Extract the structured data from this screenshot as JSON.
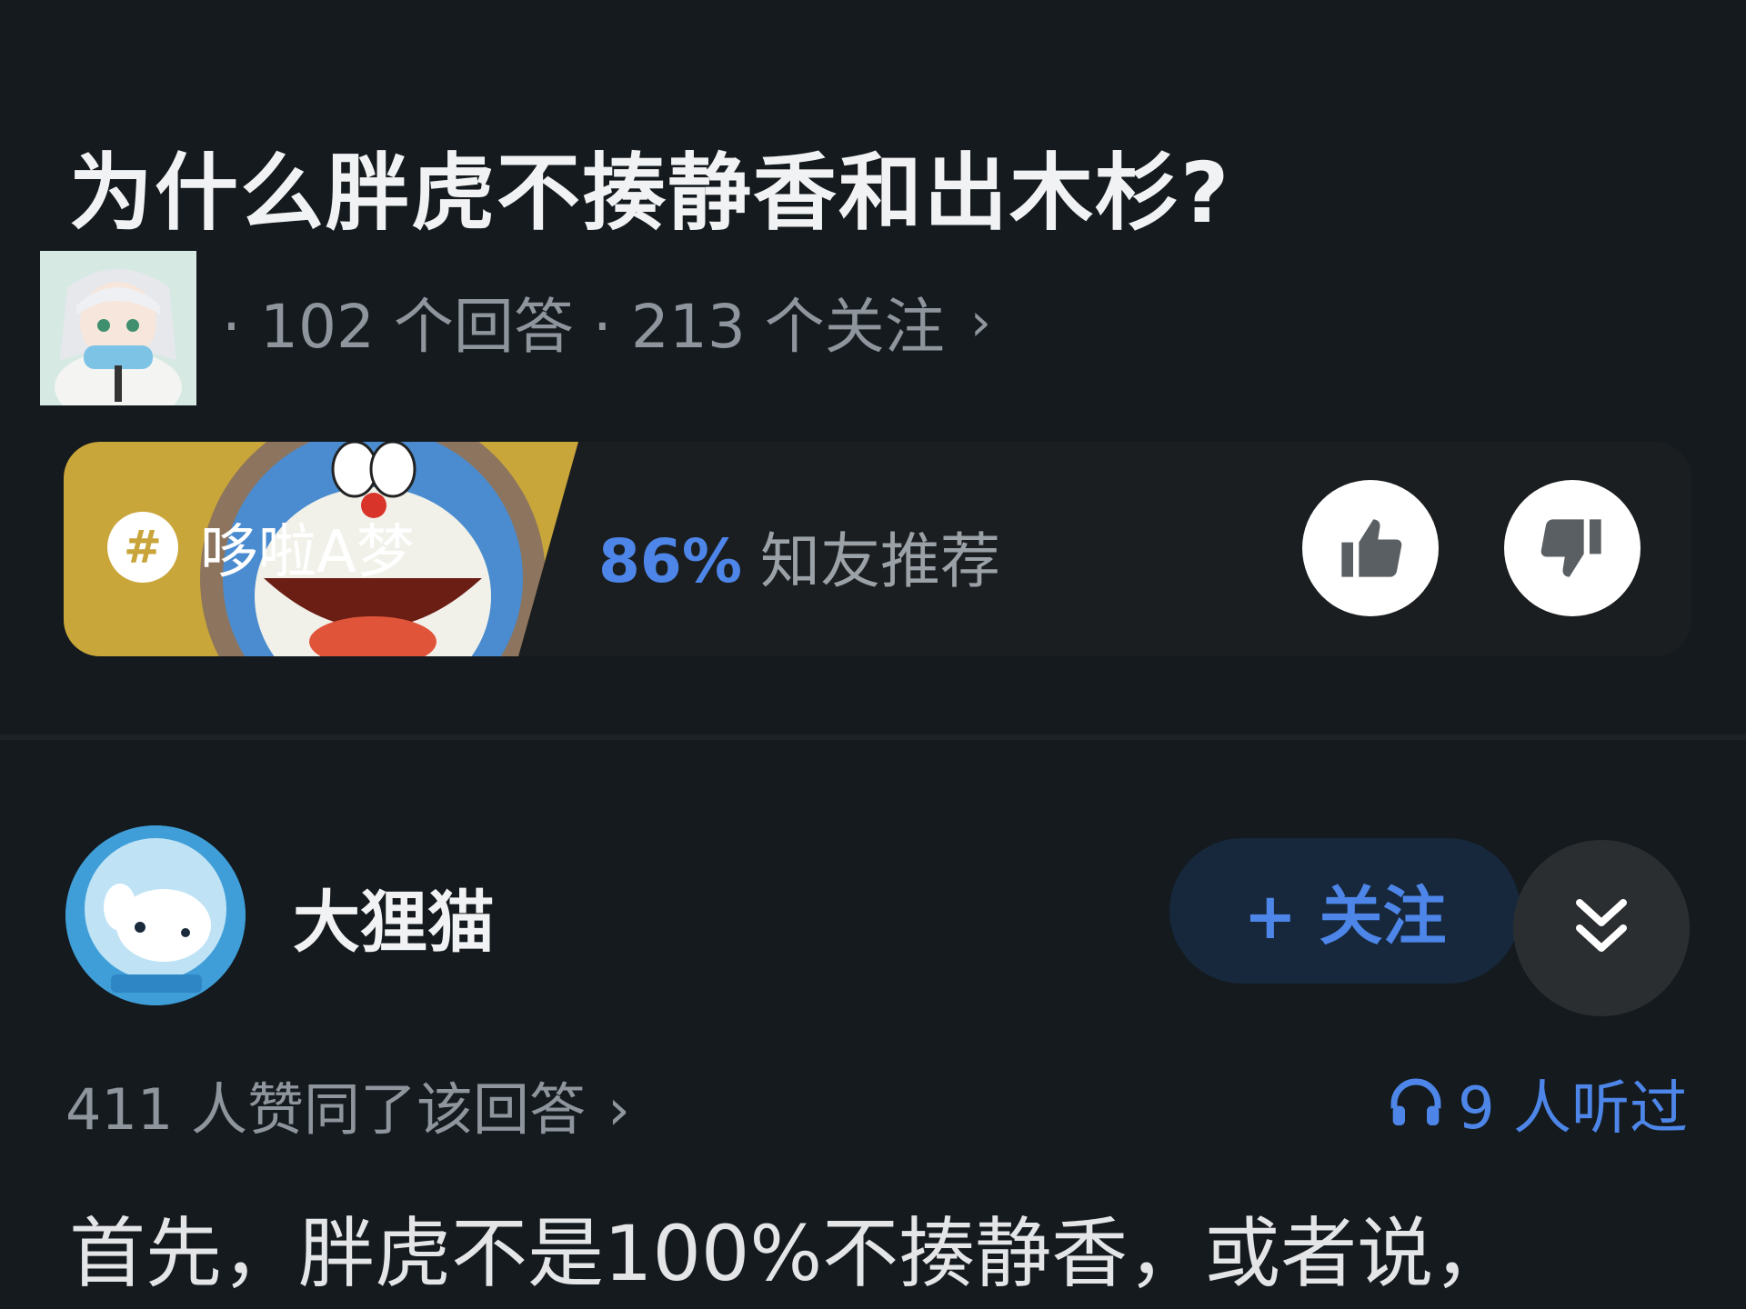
{
  "question": {
    "title": "为什么胖虎不揍静香和出木杉?",
    "meta": "· 102 个回答 · 213 个关注",
    "meta_chevron": "›",
    "avatar_icon": "anime-girl-avatar"
  },
  "topic": {
    "tag_icon": "hash-icon",
    "hash_symbol": "#",
    "name": "哆啦A梦",
    "recommend_percent": "86%",
    "recommend_label": "知友推荐",
    "thumb_colors": {
      "yellow": "#c9a63a",
      "blue": "#4a8ccf",
      "red": "#e0553a"
    }
  },
  "answer": {
    "author_name": "大狸猫",
    "follow_label": "+ 关注",
    "upvote_text": "411 人赞同了该回答",
    "upvote_chevron": "›",
    "listen_text": "9 人听过",
    "body_first_line": "首先，胖虎不是100%不揍静香，或者说，"
  },
  "colors": {
    "background": "#141a1e",
    "accent_blue": "#4d86e8",
    "muted_text": "#8e959c"
  }
}
